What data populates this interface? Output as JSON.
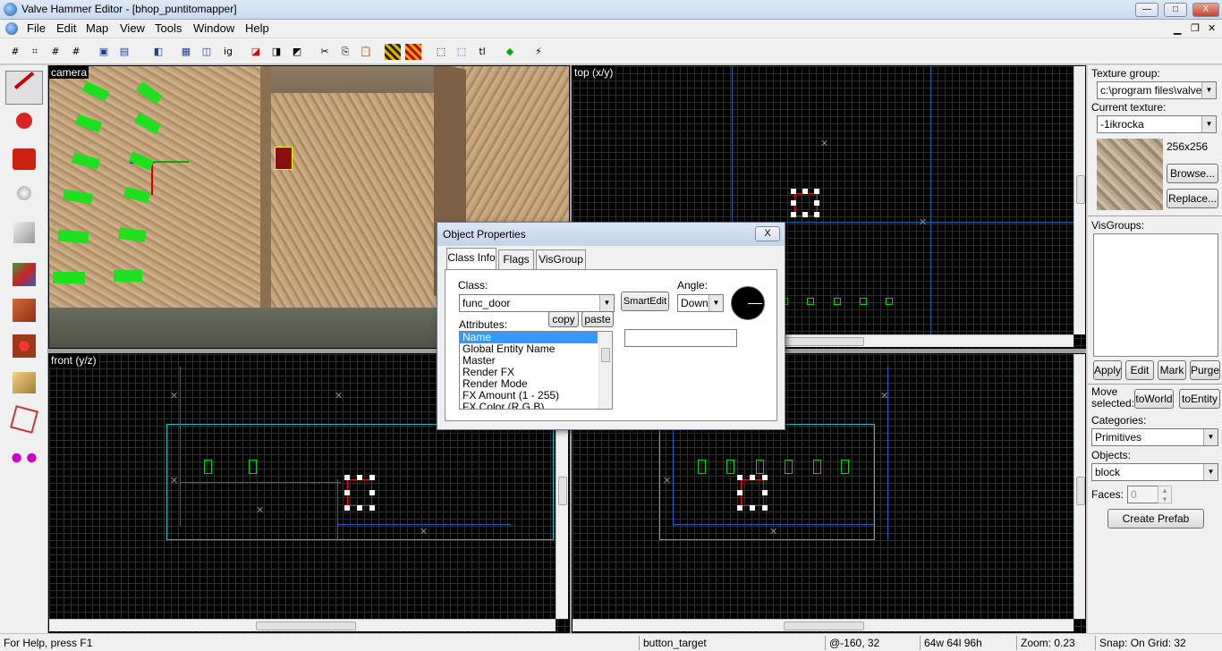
{
  "window": {
    "title": "Valve Hammer Editor - [bhop_puntitomapper]",
    "min": "—",
    "max": "□",
    "close": "X"
  },
  "menu": [
    "File",
    "Edit",
    "Map",
    "View",
    "Tools",
    "Window",
    "Help"
  ],
  "viewports": {
    "camera": "camera",
    "top": "top (x/y)",
    "front": "front (y/z)"
  },
  "right_panel": {
    "texture_group_label": "Texture group:",
    "texture_group_value": "c:\\program files\\valve\\c",
    "current_texture_label": "Current texture:",
    "current_texture_value": "-1ikrocka",
    "texture_size": "256x256",
    "browse": "Browse...",
    "replace": "Replace...",
    "visgroups_label": "VisGroups:",
    "apply": "Apply",
    "edit": "Edit",
    "mark": "Mark",
    "purge": "Purge",
    "move_selected": "Move selected:",
    "to_world": "toWorld",
    "to_entity": "toEntity",
    "categories_label": "Categories:",
    "categories_value": "Primitives",
    "objects_label": "Objects:",
    "objects_value": "block",
    "faces_label": "Faces:",
    "faces_value": "0",
    "create_prefab": "Create Prefab"
  },
  "dialog": {
    "title": "Object Properties",
    "close": "X",
    "tabs": [
      "Class Info",
      "Flags",
      "VisGroup"
    ],
    "class_label": "Class:",
    "class_value": "func_door",
    "smartedit": "SmartEdit",
    "angle_label": "Angle:",
    "angle_value": "Down",
    "attributes_label": "Attributes:",
    "copy": "copy",
    "paste": "paste",
    "attributes": [
      "Name",
      "Global Entity Name",
      "Master",
      "Render FX",
      "Render Mode",
      "FX Amount (1 - 255)",
      "FX Color (R G B)"
    ],
    "value": ""
  },
  "status": {
    "help": "For Help, press F1",
    "target": "button_target",
    "coords": "@-160, 32",
    "size": "64w 64l 96h",
    "zoom": "Zoom: 0.23",
    "snap": "Snap: On Grid: 32"
  }
}
